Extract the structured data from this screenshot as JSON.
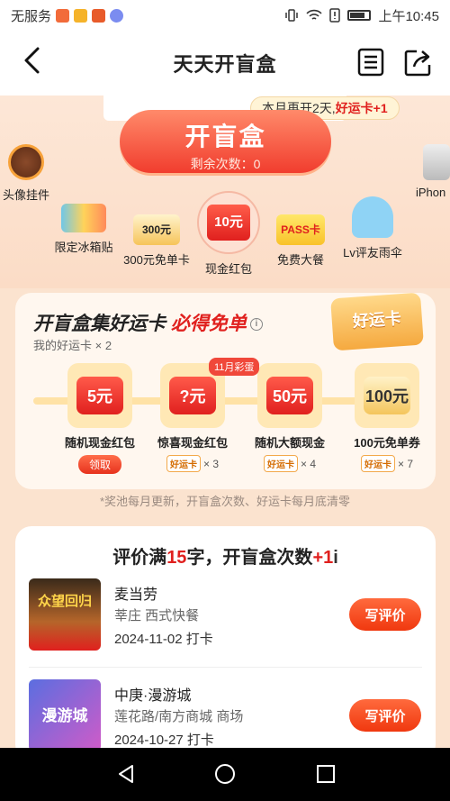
{
  "status_bar": {
    "carrier": "无服务",
    "time": "上午10:45",
    "app_icon_colors": [
      "#f26b3a",
      "#f5b32a",
      "#e85b2a",
      "#7b8cf0"
    ]
  },
  "header": {
    "title": "天天开盲盒"
  },
  "hero": {
    "month_banner_prefix": "本月再开2天,",
    "month_banner_highlight": "好运卡+1",
    "open_button_label": "开盲盒",
    "remaining_label": "剩余次数：0",
    "prizes": [
      {
        "label": "头像挂件"
      },
      {
        "label": "限定冰箱贴"
      },
      {
        "label": "300元免单卡",
        "badge": "300元"
      },
      {
        "label": "现金红包",
        "badge": "10元"
      },
      {
        "label": "免费大餐",
        "badge": "PASS卡"
      },
      {
        "label": "Lv评友雨伞"
      },
      {
        "label": "iPhon"
      }
    ]
  },
  "lucky_panel": {
    "title_prefix": "开盲盒集好运卡 ",
    "title_highlight": "必得免单",
    "my_cards": "我的好运卡 × 2",
    "badge": "好运卡",
    "egg_tag": "11月彩蛋",
    "rewards": [
      {
        "label": "随机现金红包",
        "value": "5元",
        "action": "领取"
      },
      {
        "label": "惊喜现金红包",
        "value": "?元",
        "chip": "好运卡",
        "count": "× 3"
      },
      {
        "label": "随机大额现金",
        "value": "50元",
        "chip": "好运卡",
        "count": "× 4"
      },
      {
        "label": "100元免单券",
        "value": "100元",
        "chip": "好运卡",
        "count": "× 7"
      }
    ]
  },
  "footnote": "*奖池每月更新，开盲盒次数、好运卡每月底清零",
  "review": {
    "title_prefix": "评价满",
    "title_num": "15",
    "title_mid": "字，开盲盒次数",
    "title_plus": "+1",
    "items": [
      {
        "name": "麦当劳",
        "category": "莘庄 西式快餐",
        "date": "2024-11-02 打卡",
        "button": "写评价",
        "thumb_text": "众望回归"
      },
      {
        "name": "中庚·漫游城",
        "category": "莲花路/南方商城 商场",
        "date": "2024-10-27 打卡",
        "button": "写评价",
        "thumb_text": "漫游城"
      }
    ]
  }
}
